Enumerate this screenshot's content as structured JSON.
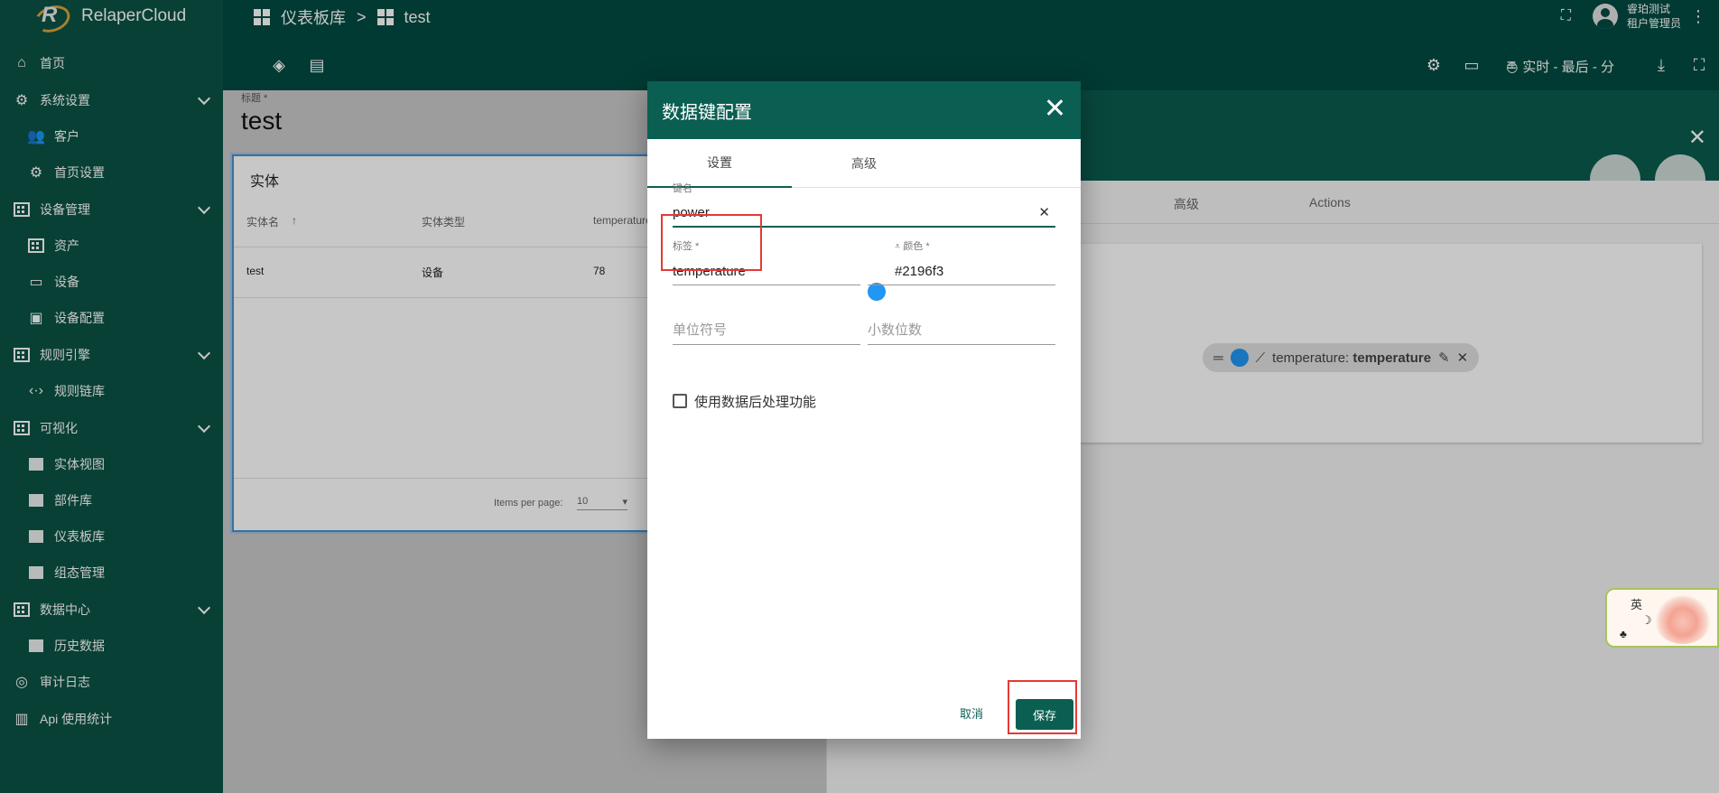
{
  "app": {
    "name": "RelaperCloud"
  },
  "breadcrumb": {
    "parent": "仪表板库",
    "separator": ">",
    "current": "test"
  },
  "user": {
    "name": "睿珀测试",
    "role": "租户管理员"
  },
  "toolbar": {
    "timewindow": "实时 - 最后 - 分"
  },
  "sidebar": {
    "items": [
      {
        "label": "首页"
      },
      {
        "label": "系统设置"
      },
      {
        "label": "客户"
      },
      {
        "label": "首页设置"
      },
      {
        "label": "设备管理"
      },
      {
        "label": "资产"
      },
      {
        "label": "设备"
      },
      {
        "label": "设备配置"
      },
      {
        "label": "规则引擎"
      },
      {
        "label": "规则链库"
      },
      {
        "label": "可视化"
      },
      {
        "label": "实体视图"
      },
      {
        "label": "部件库"
      },
      {
        "label": "仪表板库"
      },
      {
        "label": "组态管理"
      },
      {
        "label": "数据中心"
      },
      {
        "label": "历史数据"
      },
      {
        "label": "审计日志"
      },
      {
        "label": "Api 使用统计"
      }
    ]
  },
  "background": {
    "title_label": "标题 *",
    "title_value": "test",
    "widget": {
      "title": "实体",
      "columns": [
        "实体名",
        "实体类型",
        "temperature"
      ],
      "row": [
        "test",
        "设备",
        "78"
      ],
      "items_per_page_label": "Items per page:",
      "items_per_page_value": "10"
    },
    "panel_tabs": [
      "高级",
      "Actions"
    ],
    "chip": {
      "series": "temperature: ",
      "key": "temperature"
    }
  },
  "dialog": {
    "title": "数据键配置",
    "tabs": [
      "设置",
      "高级"
    ],
    "key_field": {
      "label": "键名",
      "value": "power"
    },
    "label_field": {
      "label": "标签 *",
      "value": "temperature"
    },
    "color_field": {
      "label": "颜色 *",
      "value": "#2196f3"
    },
    "units_field": {
      "placeholder": "单位符号"
    },
    "decimals_field": {
      "placeholder": "小数位数"
    },
    "postprocess_checkbox": {
      "label": "使用数据后处理功能",
      "checked": false
    },
    "cancel_label": "取消",
    "save_label": "保存"
  },
  "floater": {
    "text": "英"
  },
  "colors": {
    "sidebar": "#0b5345",
    "topbar": "#004b40",
    "accent": "#0b5f52",
    "key_color": "#2196f3",
    "highlight": "#e53935"
  }
}
